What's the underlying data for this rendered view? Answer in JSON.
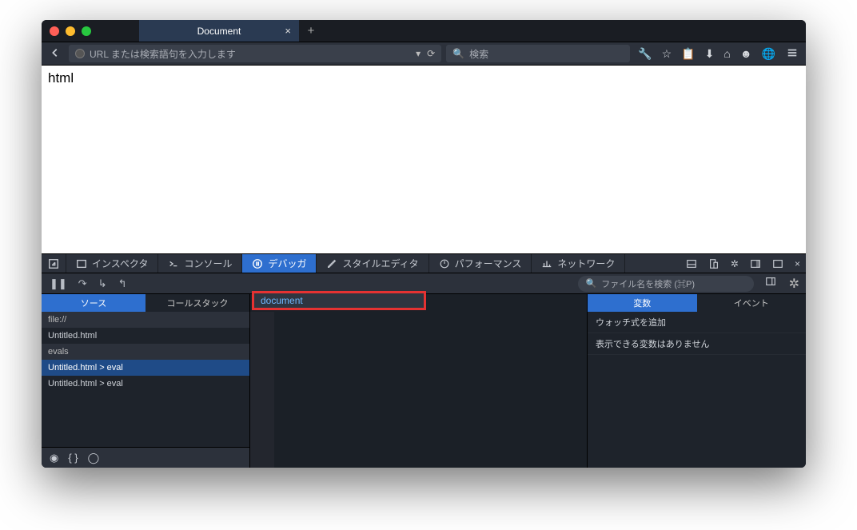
{
  "tab": {
    "title": "Document"
  },
  "navbar": {
    "url_placeholder": "URL または検索語句を入力します",
    "search_placeholder": "検索"
  },
  "page": {
    "body_text": "html"
  },
  "devtools": {
    "tabs": {
      "inspector": "インスペクタ",
      "console": "コンソール",
      "debugger": "デバッガ",
      "style": "スタイルエディタ",
      "perf": "パフォーマンス",
      "network": "ネットワーク"
    }
  },
  "debugger": {
    "file_search_placeholder": "ファイル名を検索 (⌘P)",
    "left_tabs": {
      "sources": "ソース",
      "callstack": "コールスタック"
    },
    "files": {
      "group1": "file://",
      "item1": "Untitled.html",
      "group2": "evals",
      "item2": "Untitled.html > eval",
      "item3": "Untitled.html > eval"
    },
    "editor_search": "document",
    "right_tabs": {
      "vars": "変数",
      "events": "イベント"
    },
    "watch_add": "ウォッチ式を追加",
    "no_vars": "表示できる変数はありません"
  }
}
